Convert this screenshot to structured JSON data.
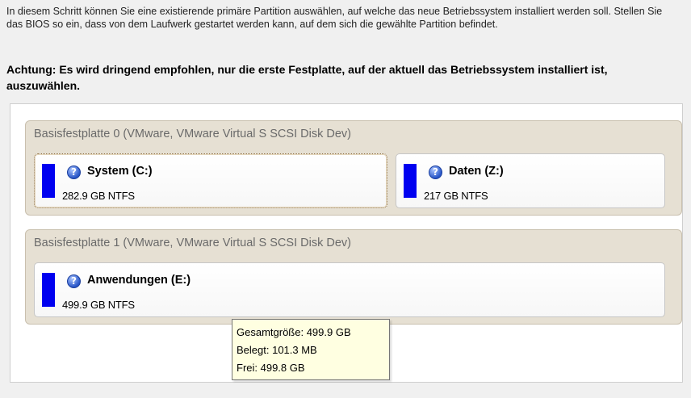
{
  "intro": {
    "text": "In diesem Schritt können Sie eine existierende primäre Partition auswählen, auf welche das neue Betriebssystem installiert werden soll. Stellen Sie das BIOS so ein, dass von dem Laufwerk gestartet werden kann, auf dem sich die gewählte Partition befindet.",
    "warning": "Achtung: Es wird dringend empfohlen, nur die erste Festplatte, auf der aktuell das Betriebssystem installiert ist, auszuwählen."
  },
  "colors": {
    "partition_bar": "#0000f0",
    "disk_background": "#e6e0d3",
    "tooltip_background": "#ffffe1"
  },
  "disks": [
    {
      "label": "Basisfestplatte 0 (VMware, VMware Virtual S SCSI Disk Dev)",
      "partitions": [
        {
          "name": "System (C:)",
          "info": "282.9 GB NTFS",
          "icon": "help-icon",
          "selected": true
        },
        {
          "name": "Daten (Z:)",
          "info": "217 GB NTFS",
          "icon": "help-icon",
          "selected": false
        }
      ]
    },
    {
      "label": "Basisfestplatte 1 (VMware, VMware Virtual S SCSI Disk Dev)",
      "partitions": [
        {
          "name": "Anwendungen (E:)",
          "info": "499.9 GB NTFS",
          "icon": "help-icon",
          "selected": false
        }
      ]
    }
  ],
  "tooltip": {
    "total": "Gesamtgröße: 499.9 GB",
    "used": "Belegt: 101.3 MB",
    "free": "Frei: 499.8 GB"
  }
}
